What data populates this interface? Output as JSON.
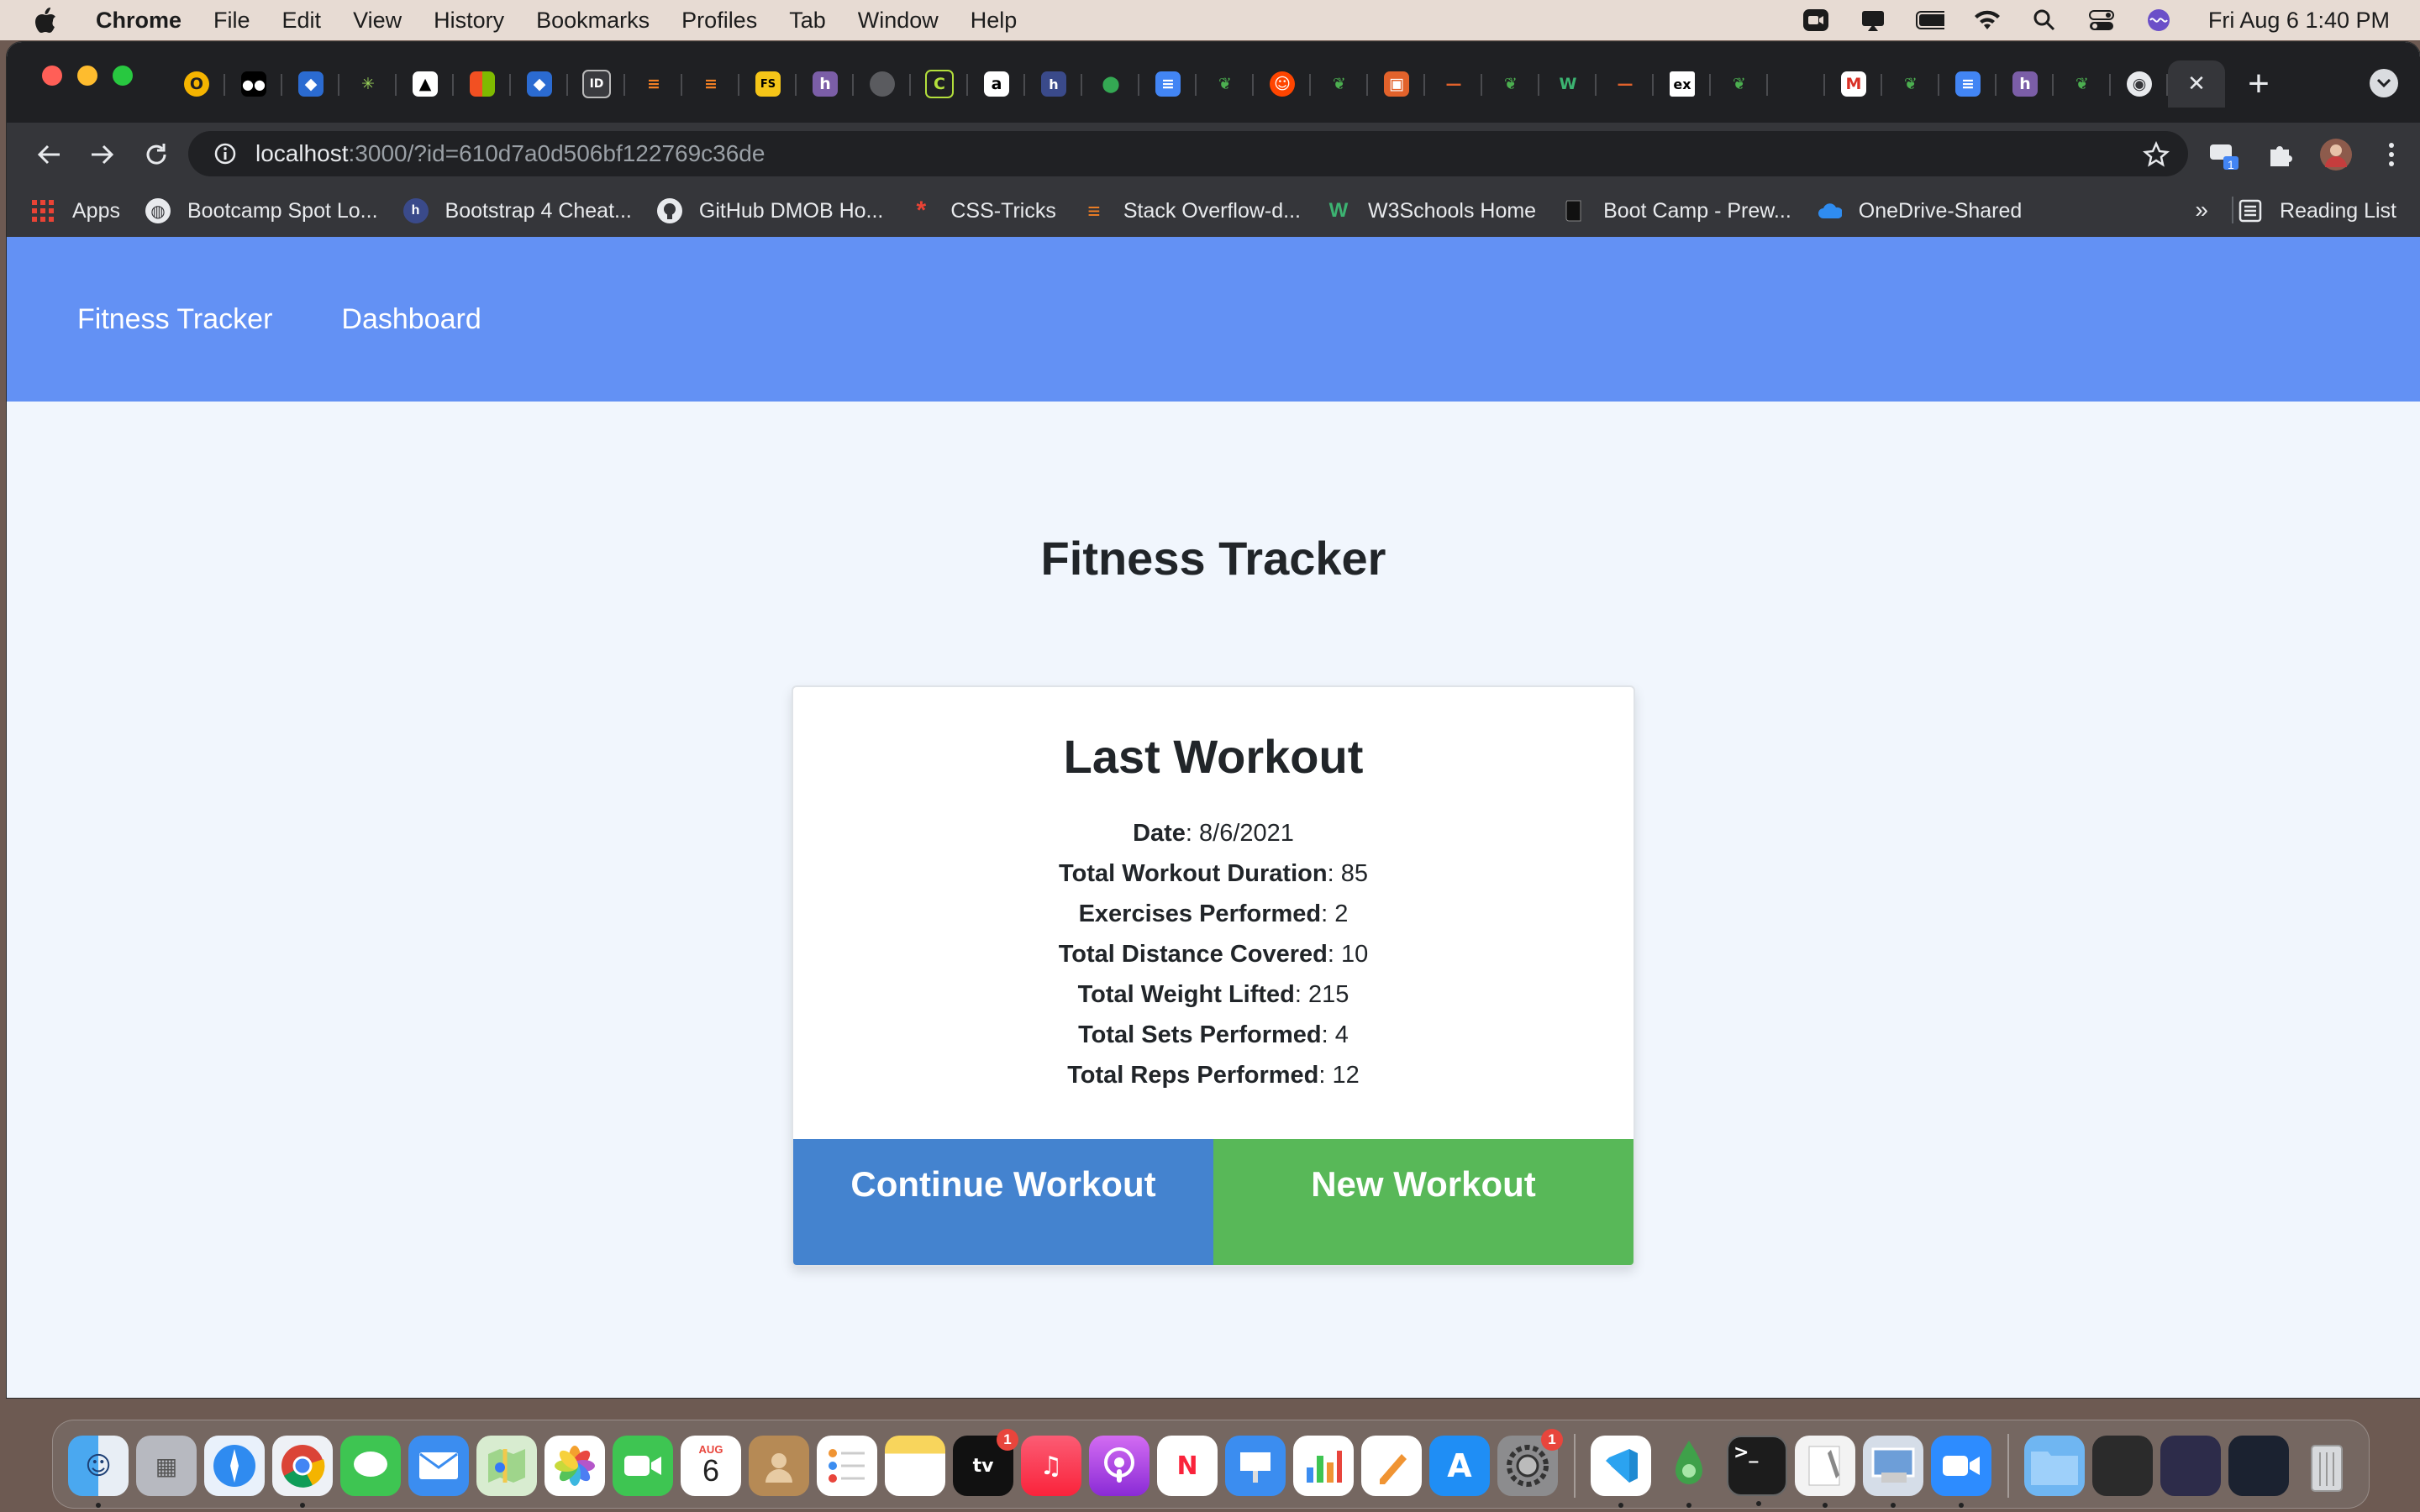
{
  "menubar": {
    "app_name": "Chrome",
    "items": [
      "File",
      "Edit",
      "View",
      "History",
      "Bookmarks",
      "Profiles",
      "Tab",
      "Window",
      "Help"
    ],
    "clock": "Fri Aug 6  1:40 PM"
  },
  "browser": {
    "url_host": "localhost",
    "url_rest": ":3000/?id=610d7a0d506bf122769c36de",
    "extension_badge": "1",
    "bookmarks": [
      {
        "label": "Apps",
        "icon": "apps-grid-icon"
      },
      {
        "label": "Bootcamp Spot Lo...",
        "icon": "globe-icon"
      },
      {
        "label": "Bootstrap 4 Cheat...",
        "icon": "hashnode-icon"
      },
      {
        "label": "GitHub DMOB Ho...",
        "icon": "github-icon"
      },
      {
        "label": "CSS-Tricks",
        "icon": "css-tricks-icon"
      },
      {
        "label": "Stack Overflow-d...",
        "icon": "stackoverflow-icon"
      },
      {
        "label": "W3Schools Home",
        "icon": "w3schools-icon"
      },
      {
        "label": "Boot Camp - Prew...",
        "icon": "book-icon"
      },
      {
        "label": "OneDrive-Shared",
        "icon": "onedrive-icon"
      }
    ],
    "reading_list": "Reading List",
    "more_bookmarks": "»"
  },
  "app": {
    "nav": {
      "brand": "Fitness Tracker",
      "dashboard": "Dashboard"
    },
    "page_title": "Fitness Tracker",
    "card": {
      "title": "Last Workout",
      "stats": [
        {
          "label": "Date",
          "value": "8/6/2021"
        },
        {
          "label": "Total Workout Duration",
          "value": "85"
        },
        {
          "label": "Exercises Performed",
          "value": "2"
        },
        {
          "label": "Total Distance Covered",
          "value": "10"
        },
        {
          "label": "Total Weight Lifted",
          "value": "215"
        },
        {
          "label": "Total Sets Performed",
          "value": "4"
        },
        {
          "label": "Total Reps Performed",
          "value": "12"
        }
      ],
      "continue_label": "Continue Workout",
      "new_label": "New Workout"
    },
    "colors": {
      "navbar": "#6391f4",
      "continue_button": "#4483cf",
      "new_button": "#58b858"
    }
  },
  "dock": {
    "calendar_month": "AUG",
    "calendar_day": "6",
    "appletv_badge": "1",
    "settings_badge": "1"
  }
}
